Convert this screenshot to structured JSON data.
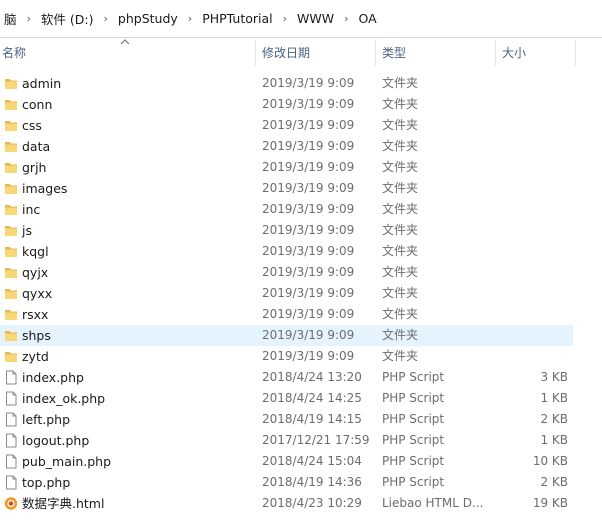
{
  "breadcrumb": {
    "items": [
      "脑",
      "软件 (D:)",
      "phpStudy",
      "PHPTutorial",
      "WWW",
      "OA"
    ],
    "separator": "›"
  },
  "columns": {
    "name": "名称",
    "modified": "修改日期",
    "type": "类型",
    "size": "大小"
  },
  "colors": {
    "folder": "#f8d775",
    "folder_dark": "#e8b64b",
    "selected": "#e5f3ff",
    "header_text": "#4d6082"
  },
  "files": [
    {
      "name": "admin",
      "date": "2019/3/19 9:09",
      "type": "文件夹",
      "size": "",
      "icon": "folder-icon"
    },
    {
      "name": "conn",
      "date": "2019/3/19 9:09",
      "type": "文件夹",
      "size": "",
      "icon": "folder-icon"
    },
    {
      "name": "css",
      "date": "2019/3/19 9:09",
      "type": "文件夹",
      "size": "",
      "icon": "folder-icon"
    },
    {
      "name": "data",
      "date": "2019/3/19 9:09",
      "type": "文件夹",
      "size": "",
      "icon": "folder-icon"
    },
    {
      "name": "grjh",
      "date": "2019/3/19 9:09",
      "type": "文件夹",
      "size": "",
      "icon": "folder-icon"
    },
    {
      "name": "images",
      "date": "2019/3/19 9:09",
      "type": "文件夹",
      "size": "",
      "icon": "folder-icon"
    },
    {
      "name": "inc",
      "date": "2019/3/19 9:09",
      "type": "文件夹",
      "size": "",
      "icon": "folder-icon"
    },
    {
      "name": "js",
      "date": "2019/3/19 9:09",
      "type": "文件夹",
      "size": "",
      "icon": "folder-icon"
    },
    {
      "name": "kqgl",
      "date": "2019/3/19 9:09",
      "type": "文件夹",
      "size": "",
      "icon": "folder-icon"
    },
    {
      "name": "qyjx",
      "date": "2019/3/19 9:09",
      "type": "文件夹",
      "size": "",
      "icon": "folder-icon"
    },
    {
      "name": "qyxx",
      "date": "2019/3/19 9:09",
      "type": "文件夹",
      "size": "",
      "icon": "folder-icon"
    },
    {
      "name": "rsxx",
      "date": "2019/3/19 9:09",
      "type": "文件夹",
      "size": "",
      "icon": "folder-icon"
    },
    {
      "name": "shps",
      "date": "2019/3/19 9:09",
      "type": "文件夹",
      "size": "",
      "icon": "folder-icon",
      "selected": true
    },
    {
      "name": "zytd",
      "date": "2019/3/19 9:09",
      "type": "文件夹",
      "size": "",
      "icon": "folder-icon"
    },
    {
      "name": "index.php",
      "date": "2018/4/24 13:20",
      "type": "PHP Script",
      "size": "3 KB",
      "icon": "file-icon"
    },
    {
      "name": "index_ok.php",
      "date": "2018/4/24 14:25",
      "type": "PHP Script",
      "size": "1 KB",
      "icon": "file-icon"
    },
    {
      "name": "left.php",
      "date": "2018/4/19 14:15",
      "type": "PHP Script",
      "size": "2 KB",
      "icon": "file-icon"
    },
    {
      "name": "logout.php",
      "date": "2017/12/21 17:59",
      "type": "PHP Script",
      "size": "1 KB",
      "icon": "file-icon"
    },
    {
      "name": "pub_main.php",
      "date": "2018/4/24 15:04",
      "type": "PHP Script",
      "size": "10 KB",
      "icon": "file-icon"
    },
    {
      "name": "top.php",
      "date": "2018/4/19 14:36",
      "type": "PHP Script",
      "size": "2 KB",
      "icon": "file-icon"
    },
    {
      "name": "数据字典.html",
      "date": "2018/4/23 10:29",
      "type": "Liebao HTML D...",
      "size": "19 KB",
      "icon": "browser-html-icon"
    }
  ]
}
